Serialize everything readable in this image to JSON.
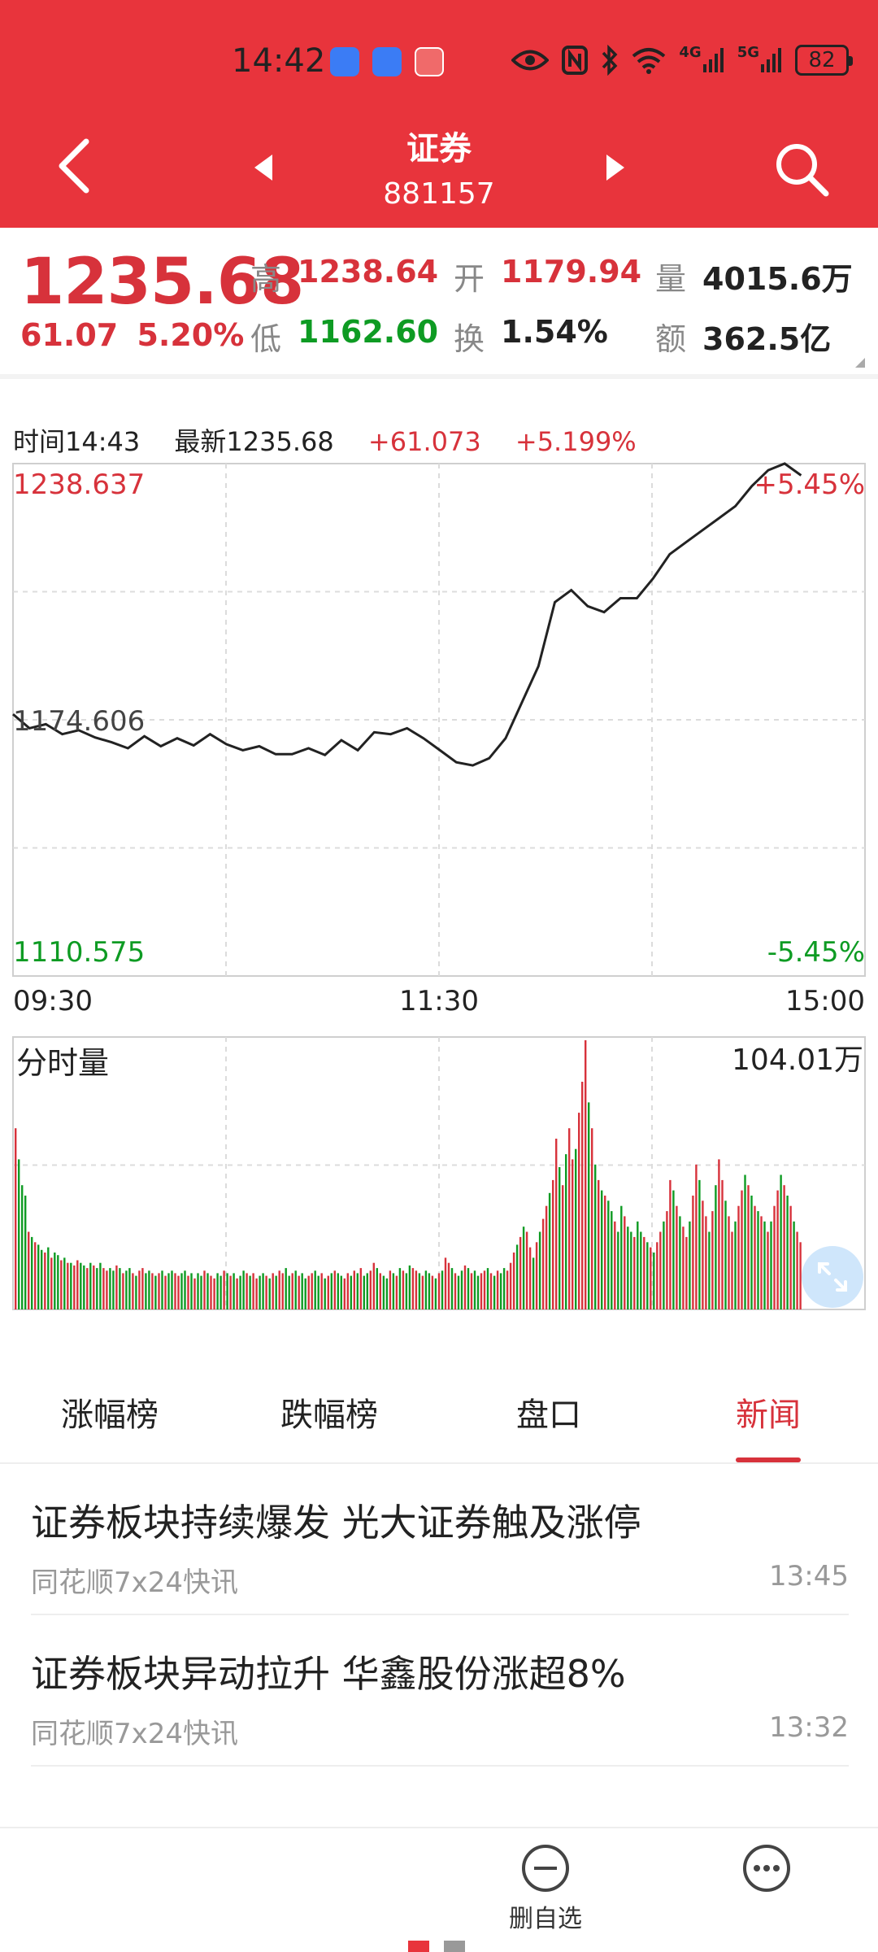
{
  "status_bar": {
    "time": "14:42",
    "network_4g": "4G",
    "network_5g": "5G",
    "battery": "82"
  },
  "header": {
    "title": "证券",
    "code": "881157"
  },
  "quote": {
    "price": "1235.68",
    "change": "61.07",
    "change_pct": "5.20%",
    "high_label": "高",
    "high": "1238.64",
    "low_label": "低",
    "low": "1162.60",
    "open_label": "开",
    "open": "1179.94",
    "turnover_label": "换",
    "turnover": "1.54%",
    "volume_label": "量",
    "volume": "4015.6万",
    "amount_label": "额",
    "amount": "362.5亿"
  },
  "info_line": {
    "time": "时间14:43",
    "latest": "最新1235.68",
    "change": "+61.073",
    "change_pct": "+5.199%"
  },
  "colors": {
    "up": "#d7323b",
    "down": "#0e9b23",
    "header": "#e8343c"
  },
  "chart_data": {
    "type": "line",
    "title": "",
    "y_axis_labels": {
      "top": "1238.637",
      "middle": "1174.606",
      "bottom": "1110.575"
    },
    "pct_labels": {
      "top": "+5.45%",
      "bottom": "-5.45%"
    },
    "x_tick_labels": [
      "09:30",
      "11:30",
      "15:00"
    ],
    "ylim": [
      1110.575,
      1238.637
    ],
    "baseline": 1174.606,
    "x_minutes": [
      0,
      5,
      10,
      15,
      20,
      25,
      30,
      35,
      40,
      45,
      50,
      55,
      60,
      65,
      70,
      75,
      80,
      85,
      90,
      95,
      100,
      105,
      110,
      115,
      120,
      125,
      130,
      135,
      140,
      145,
      150,
      155,
      160,
      165,
      170,
      175,
      180,
      185,
      190,
      195,
      200,
      205,
      210,
      215,
      220,
      225,
      230,
      235,
      240
    ],
    "price": [
      1176.0,
      1172.5,
      1173.5,
      1171.0,
      1172.0,
      1170.2,
      1169.0,
      1167.5,
      1170.5,
      1168.0,
      1170.0,
      1168.2,
      1171.0,
      1168.5,
      1167.0,
      1168.0,
      1166.0,
      1166.0,
      1167.5,
      1165.8,
      1169.5,
      1167.0,
      1171.5,
      1171.0,
      1172.5,
      1170.0,
      1167.0,
      1164.0,
      1163.2,
      1165.0,
      1170.0,
      1179.0,
      1188.0,
      1204.0,
      1207.0,
      1203.0,
      1201.5,
      1205.0,
      1205.0,
      1210.0,
      1216.0,
      1219.0,
      1222.0,
      1225.0,
      1228.0,
      1233.0,
      1237.0,
      1238.637,
      1235.68
    ],
    "volume_label": "分时量",
    "volume_max_label": "104.01万",
    "volume_max": 104.01,
    "volume": [
      70,
      58,
      48,
      44,
      30,
      28,
      26,
      25,
      23,
      22,
      24,
      20,
      22,
      21,
      19,
      20,
      18,
      18,
      17,
      19,
      18,
      17,
      16,
      18,
      17,
      16,
      18,
      16,
      15,
      16,
      15,
      17,
      16,
      14,
      15,
      16,
      14,
      13,
      15,
      16,
      14,
      15,
      14,
      13,
      14,
      15,
      13,
      14,
      15,
      14,
      13,
      14,
      15,
      13,
      14,
      12,
      14,
      13,
      15,
      14,
      13,
      12,
      14,
      13,
      15,
      14,
      13,
      14,
      12,
      13,
      15,
      14,
      13,
      14,
      12,
      13,
      14,
      13,
      12,
      14,
      13,
      15,
      14,
      16,
      13,
      14,
      15,
      13,
      14,
      12,
      13,
      14,
      15,
      13,
      14,
      12,
      13,
      14,
      15,
      14,
      13,
      12,
      14,
      13,
      15,
      14,
      16,
      13,
      14,
      15,
      18,
      16,
      14,
      13,
      12,
      15,
      14,
      13,
      16,
      15,
      14,
      17,
      16,
      15,
      14,
      13,
      15,
      14,
      13,
      12,
      14,
      15,
      20,
      18,
      16,
      14,
      13,
      15,
      17,
      16,
      14,
      15,
      13,
      14,
      15,
      16,
      14,
      13,
      15,
      14,
      16,
      15,
      18,
      22,
      25,
      28,
      32,
      30,
      24,
      20,
      26,
      30,
      35,
      40,
      45,
      50,
      66,
      55,
      48,
      60,
      70,
      58,
      62,
      76,
      88,
      104,
      80,
      70,
      56,
      50,
      46,
      44,
      42,
      38,
      34,
      30,
      40,
      36,
      32,
      30,
      28,
      34,
      30,
      28,
      26,
      24,
      22,
      26,
      30,
      34,
      38,
      50,
      46,
      40,
      36,
      32,
      28,
      34,
      44,
      56,
      50,
      42,
      36,
      30,
      38,
      48,
      58,
      50,
      42,
      36,
      30,
      34,
      40,
      46,
      52,
      48,
      44,
      40,
      38,
      36,
      34,
      30,
      34,
      40,
      46,
      52,
      48,
      44,
      40,
      34,
      30,
      26
    ],
    "volume_up": [
      1,
      0,
      0,
      0,
      1,
      0,
      1,
      0,
      0,
      1,
      0,
      1,
      0,
      0,
      1,
      0,
      1,
      0,
      1,
      1,
      0,
      0,
      1,
      0,
      1,
      0,
      0,
      1,
      1,
      0,
      0,
      1,
      0,
      1,
      0,
      0,
      1,
      0,
      1,
      1,
      0,
      0,
      1,
      0,
      1,
      0,
      1,
      0,
      0,
      1,
      1,
      0,
      0,
      1,
      0,
      1,
      0,
      0,
      1,
      0,
      1,
      1,
      0,
      0,
      1,
      0,
      1,
      0,
      1,
      0,
      0,
      1,
      0,
      1,
      1,
      0,
      0,
      1,
      0,
      1,
      0,
      1,
      1,
      0,
      0,
      1,
      0,
      1,
      0,
      0,
      1,
      1,
      0,
      0,
      1,
      0,
      1,
      0,
      1,
      0,
      0,
      1,
      1,
      0,
      1,
      0,
      1,
      0,
      0,
      1,
      1,
      0,
      1,
      0,
      0,
      1,
      0,
      1,
      0,
      1,
      0,
      0,
      1,
      1,
      0,
      1,
      0,
      0,
      1,
      0,
      1,
      0,
      1,
      1,
      0,
      1,
      0,
      0,
      1,
      0,
      1,
      0,
      0,
      1,
      1,
      0,
      1,
      0,
      1,
      0,
      0,
      1,
      1,
      1,
      0,
      1,
      0,
      1,
      1,
      0,
      1,
      0,
      1,
      1,
      0,
      1,
      1,
      0,
      1,
      0,
      1,
      1,
      0,
      1,
      1,
      1,
      0,
      1,
      0,
      1,
      0,
      1,
      0,
      0,
      1,
      0,
      0,
      1,
      0,
      0,
      1,
      0,
      0,
      1,
      0,
      1,
      0,
      1,
      1,
      0,
      1,
      1,
      0,
      1,
      0,
      1,
      1,
      0,
      1,
      1,
      0,
      1,
      1,
      0,
      1,
      0,
      1,
      1,
      0,
      1,
      1,
      0,
      1,
      1,
      0,
      1,
      0,
      1,
      0,
      1,
      0,
      1,
      0,
      1,
      1,
      0,
      1,
      0,
      1,
      0,
      1,
      1,
      0,
      1,
      0
    ]
  },
  "tabs": [
    {
      "label": "涨幅榜"
    },
    {
      "label": "跌幅榜"
    },
    {
      "label": "盘口"
    },
    {
      "label": "新闻"
    }
  ],
  "news": [
    {
      "title": "证券板块持续爆发 光大证券触及涨停",
      "source": "同花顺7x24快讯",
      "time": "13:45"
    },
    {
      "title": "证券板块异动拉升 华鑫股份涨超8%",
      "source": "同花顺7x24快讯",
      "time": "13:32"
    }
  ],
  "bottom_bar": {
    "remove_label": "删自选"
  },
  "icons": [
    "back-arrow-icon",
    "prev-triangle-icon",
    "next-triangle-icon",
    "search-icon",
    "expand-icon",
    "remove-circle-icon",
    "more-icon"
  ]
}
